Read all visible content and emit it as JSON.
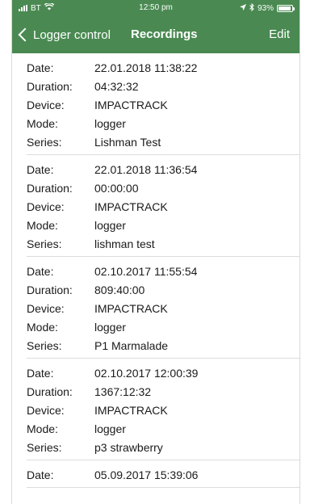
{
  "status_bar": {
    "carrier": "BT",
    "time": "12:50 pm",
    "battery": "93%",
    "battery_level": 0.93,
    "icons": [
      "signal-bars-icon",
      "wifi-icon",
      "location-arrow-icon",
      "bluetooth-icon",
      "battery-icon"
    ]
  },
  "nav": {
    "back_label": "Logger control",
    "title": "Recordings",
    "edit_label": "Edit"
  },
  "labels": {
    "date": "Date:",
    "duration": "Duration:",
    "device": "Device:",
    "mode": "Mode:",
    "series": "Series:"
  },
  "recordings": [
    {
      "date": "22.01.2018 11:38:22",
      "duration": "04:32:32",
      "device": "IMPACTRACK",
      "mode": "logger",
      "series": "Lishman Test"
    },
    {
      "date": "22.01.2018 11:36:54",
      "duration": "00:00:00",
      "device": "IMPACTRACK",
      "mode": "logger",
      "series": "lishman test"
    },
    {
      "date": "02.10.2017 11:55:54",
      "duration": "809:40:00",
      "device": "IMPACTRACK",
      "mode": "logger",
      "series": "P1 Marmalade"
    },
    {
      "date": "02.10.2017 12:00:39",
      "duration": "1367:12:32",
      "device": "IMPACTRACK",
      "mode": "logger",
      "series": "p3 strawberry"
    },
    {
      "date": "05.09.2017 15:39:06"
    }
  ],
  "colors": {
    "accent": "#4a8a52",
    "separator": "#dcdcdc"
  }
}
